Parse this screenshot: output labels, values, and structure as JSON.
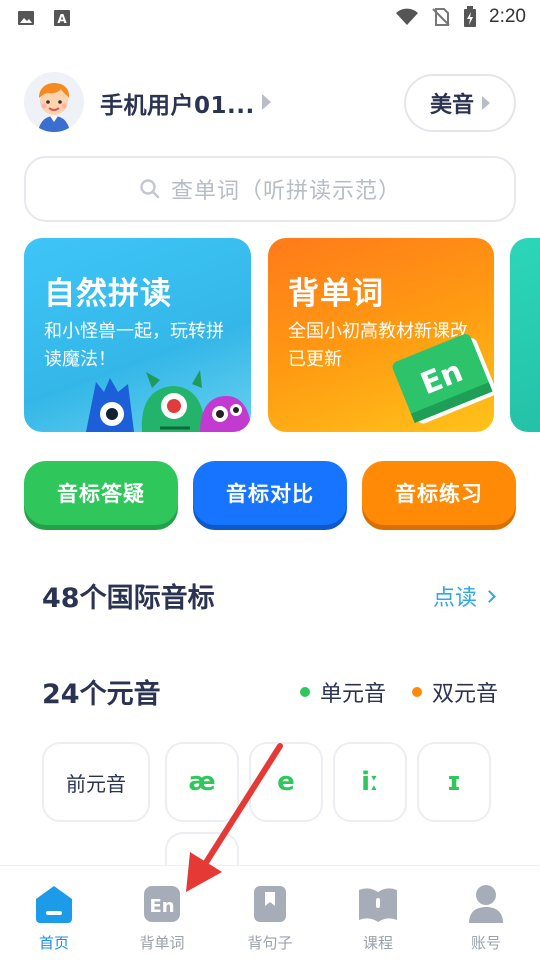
{
  "status_bar": {
    "time": "2:20",
    "icons": [
      "image-icon",
      "text-a-icon",
      "wifi-icon",
      "no-sim-icon",
      "battery-charging-icon"
    ]
  },
  "header": {
    "username": "手机用户01...",
    "accent_label": "美音"
  },
  "search": {
    "placeholder": "查单词（听拼读示范）"
  },
  "cards": [
    {
      "title": "自然拼读",
      "subtitle": "和小怪兽一起，玩转拼读魔法！",
      "color": "#3ec5f7"
    },
    {
      "title": "背单词",
      "subtitle": "全国小初高教材新课改已更新",
      "color": "#ff8a05",
      "badge": "En"
    }
  ],
  "chips": [
    {
      "label": "音标答疑",
      "color": "#2fc75c"
    },
    {
      "label": "音标对比",
      "color": "#1674ff"
    },
    {
      "label": "音标练习",
      "color": "#ff8a05"
    }
  ],
  "phonetics_section": {
    "title": "48个国际音标",
    "link_label": "点读"
  },
  "vowels_section": {
    "title": "24个元音",
    "legend": [
      {
        "label": "单元音",
        "color": "#2fc75c"
      },
      {
        "label": "双元音",
        "color": "#ff8a05"
      }
    ],
    "row_label": "前元音",
    "symbols": [
      "æ",
      "e",
      "iː",
      "ɪ"
    ]
  },
  "tab_bar": {
    "active": "首页",
    "tabs": [
      {
        "label": "首页",
        "icon": "home-icon"
      },
      {
        "label": "背单词",
        "icon": "en-book-icon"
      },
      {
        "label": "背句子",
        "icon": "bookmark-icon"
      },
      {
        "label": "课程",
        "icon": "course-book-icon"
      },
      {
        "label": "账号",
        "icon": "user-icon"
      }
    ]
  },
  "colors": {
    "accent_blue": "#1c8fe6",
    "text_dark": "#2b3352",
    "annotation_arrow": "#e53935"
  }
}
